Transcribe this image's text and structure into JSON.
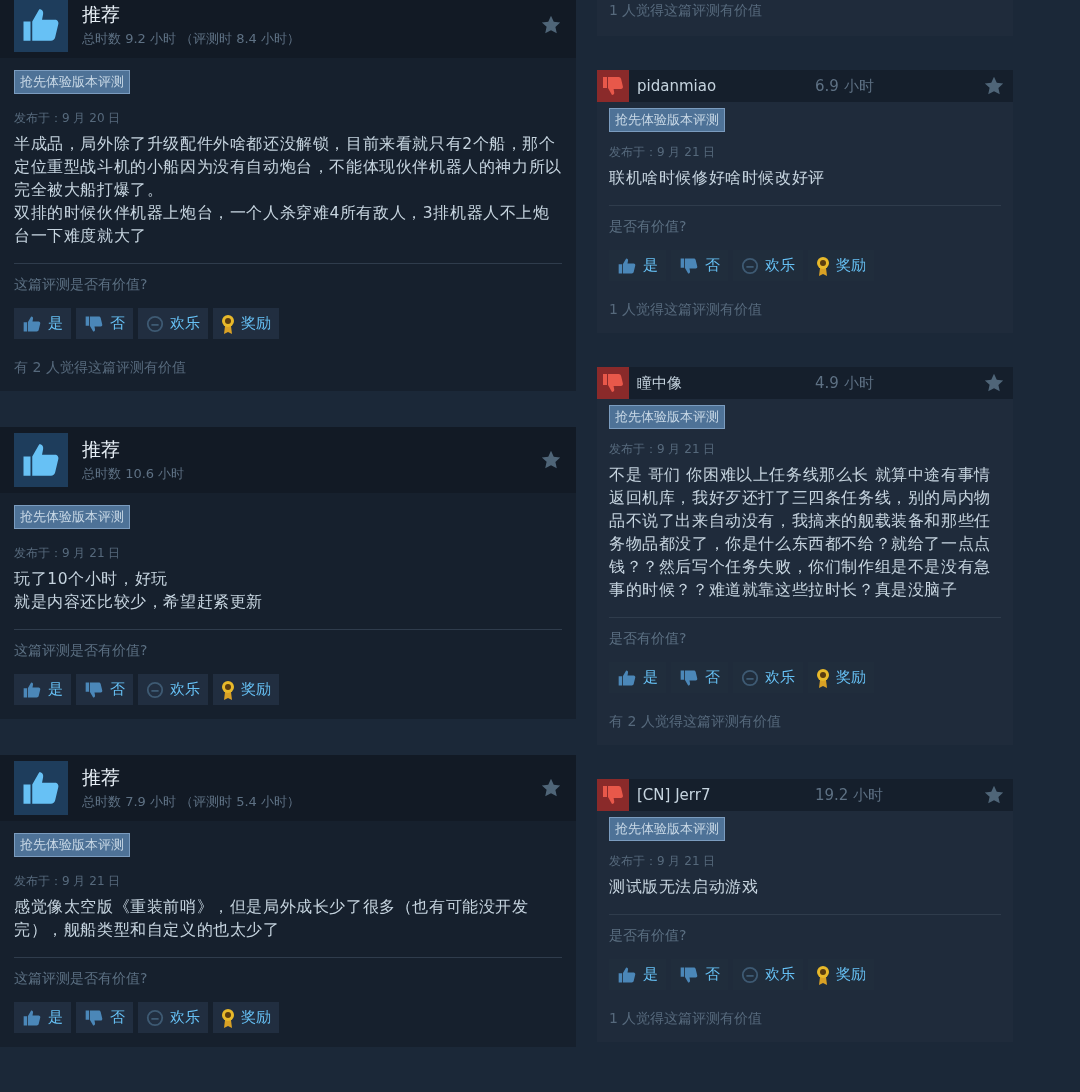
{
  "left_reviews": [
    {
      "negative": false,
      "title": "推荐",
      "hours": "总时数 9.2 小时 （评测时 8.4 小时）",
      "badge": "抢先体验版本评测",
      "date": "发布于：9 月 20 日",
      "body": [
        "半成品，局外除了升级配件外啥都还没解锁，目前来看就只有2个船，那个定位重型战斗机的小船因为没有自动炮台，不能体现伙伴机器人的神力所以完全被大船打爆了。",
        "双排的时候伙伴机器上炮台，一个人杀穿难4所有敌人，3排机器人不上炮台一下难度就大了"
      ],
      "question": "这篇评测是否有价值?",
      "buttons": [
        {
          "kind": "yes",
          "label": "是"
        },
        {
          "kind": "no",
          "label": "否"
        },
        {
          "kind": "funny",
          "label": "欢乐"
        },
        {
          "kind": "award",
          "label": "奖励"
        }
      ],
      "helpful": "有 2 人觉得这篇评测有价值"
    },
    {
      "negative": false,
      "title": "推荐",
      "hours": "总时数 10.6 小时",
      "badge": "抢先体验版本评测",
      "date": "发布于：9 月 21 日",
      "body": [
        "玩了10个小时，好玩",
        "就是内容还比较少，希望赶紧更新"
      ],
      "question": "这篇评测是否有价值?",
      "buttons": [
        {
          "kind": "yes",
          "label": "是"
        },
        {
          "kind": "no",
          "label": "否"
        },
        {
          "kind": "funny",
          "label": "欢乐"
        },
        {
          "kind": "award",
          "label": "奖励"
        }
      ]
    },
    {
      "negative": false,
      "title": "推荐",
      "hours": "总时数 7.9 小时 （评测时 5.4 小时）",
      "badge": "抢先体验版本评测",
      "date": "发布于：9 月 21 日",
      "body": [
        "感觉像太空版《重装前哨》，但是局外成长少了很多（也有可能没开发完），舰船类型和自定义的也太少了"
      ],
      "question": "这篇评测是否有价值?",
      "buttons": [
        {
          "kind": "yes",
          "label": "是"
        },
        {
          "kind": "no",
          "label": "否"
        },
        {
          "kind": "funny",
          "label": "欢乐"
        },
        {
          "kind": "award",
          "label": "奖励"
        }
      ]
    }
  ],
  "right_column": {
    "top_note": "1 人觉得这篇评测有价值",
    "reviews": [
      {
        "negative": true,
        "author": "pidanmiao",
        "hours": "6.9 小时",
        "badge": "抢先体验版本评测",
        "date": "发布于：9 月 21 日",
        "body": [
          "联机啥时候修好啥时候改好评"
        ],
        "question": "是否有价值?",
        "buttons": [
          {
            "kind": "yes",
            "label": "是"
          },
          {
            "kind": "no",
            "label": "否"
          },
          {
            "kind": "funny",
            "label": "欢乐"
          },
          {
            "kind": "award",
            "label": "奖励"
          }
        ],
        "helpful": "1 人觉得这篇评测有价值"
      },
      {
        "negative": true,
        "author": "瞳中像",
        "hours": "4.9 小时",
        "badge": "抢先体验版本评测",
        "date": "发布于：9 月 21 日",
        "body": [
          "不是 哥们 你困难以上任务线那么长 就算中途有事情返回机库，我好歹还打了三四条任务线，别的局内物品不说了出来自动没有，我搞来的舰载装备和那些任务物品都没了，你是什么东西都不给？就给了一点点钱？？然后写个任务失败，你们制作组是不是没有急事的时候？？难道就靠这些拉时长？真是没脑子"
        ],
        "question": "是否有价值?",
        "buttons": [
          {
            "kind": "yes",
            "label": "是"
          },
          {
            "kind": "no",
            "label": "否"
          },
          {
            "kind": "funny",
            "label": "欢乐"
          },
          {
            "kind": "award",
            "label": "奖励"
          }
        ],
        "helpful": "有 2 人觉得这篇评测有价值"
      },
      {
        "negative": true,
        "author": "[CN] Jerr7",
        "hours": "19.2 小时",
        "badge": "抢先体验版本评测",
        "date": "发布于：9 月 21 日",
        "body": [
          "测试版无法启动游戏"
        ],
        "question": "是否有价值?",
        "buttons": [
          {
            "kind": "yes",
            "label": "是"
          },
          {
            "kind": "no",
            "label": "否"
          },
          {
            "kind": "funny",
            "label": "欢乐"
          },
          {
            "kind": "award",
            "label": "奖励"
          }
        ],
        "helpful": "1 人觉得这篇评测有价值"
      }
    ]
  }
}
